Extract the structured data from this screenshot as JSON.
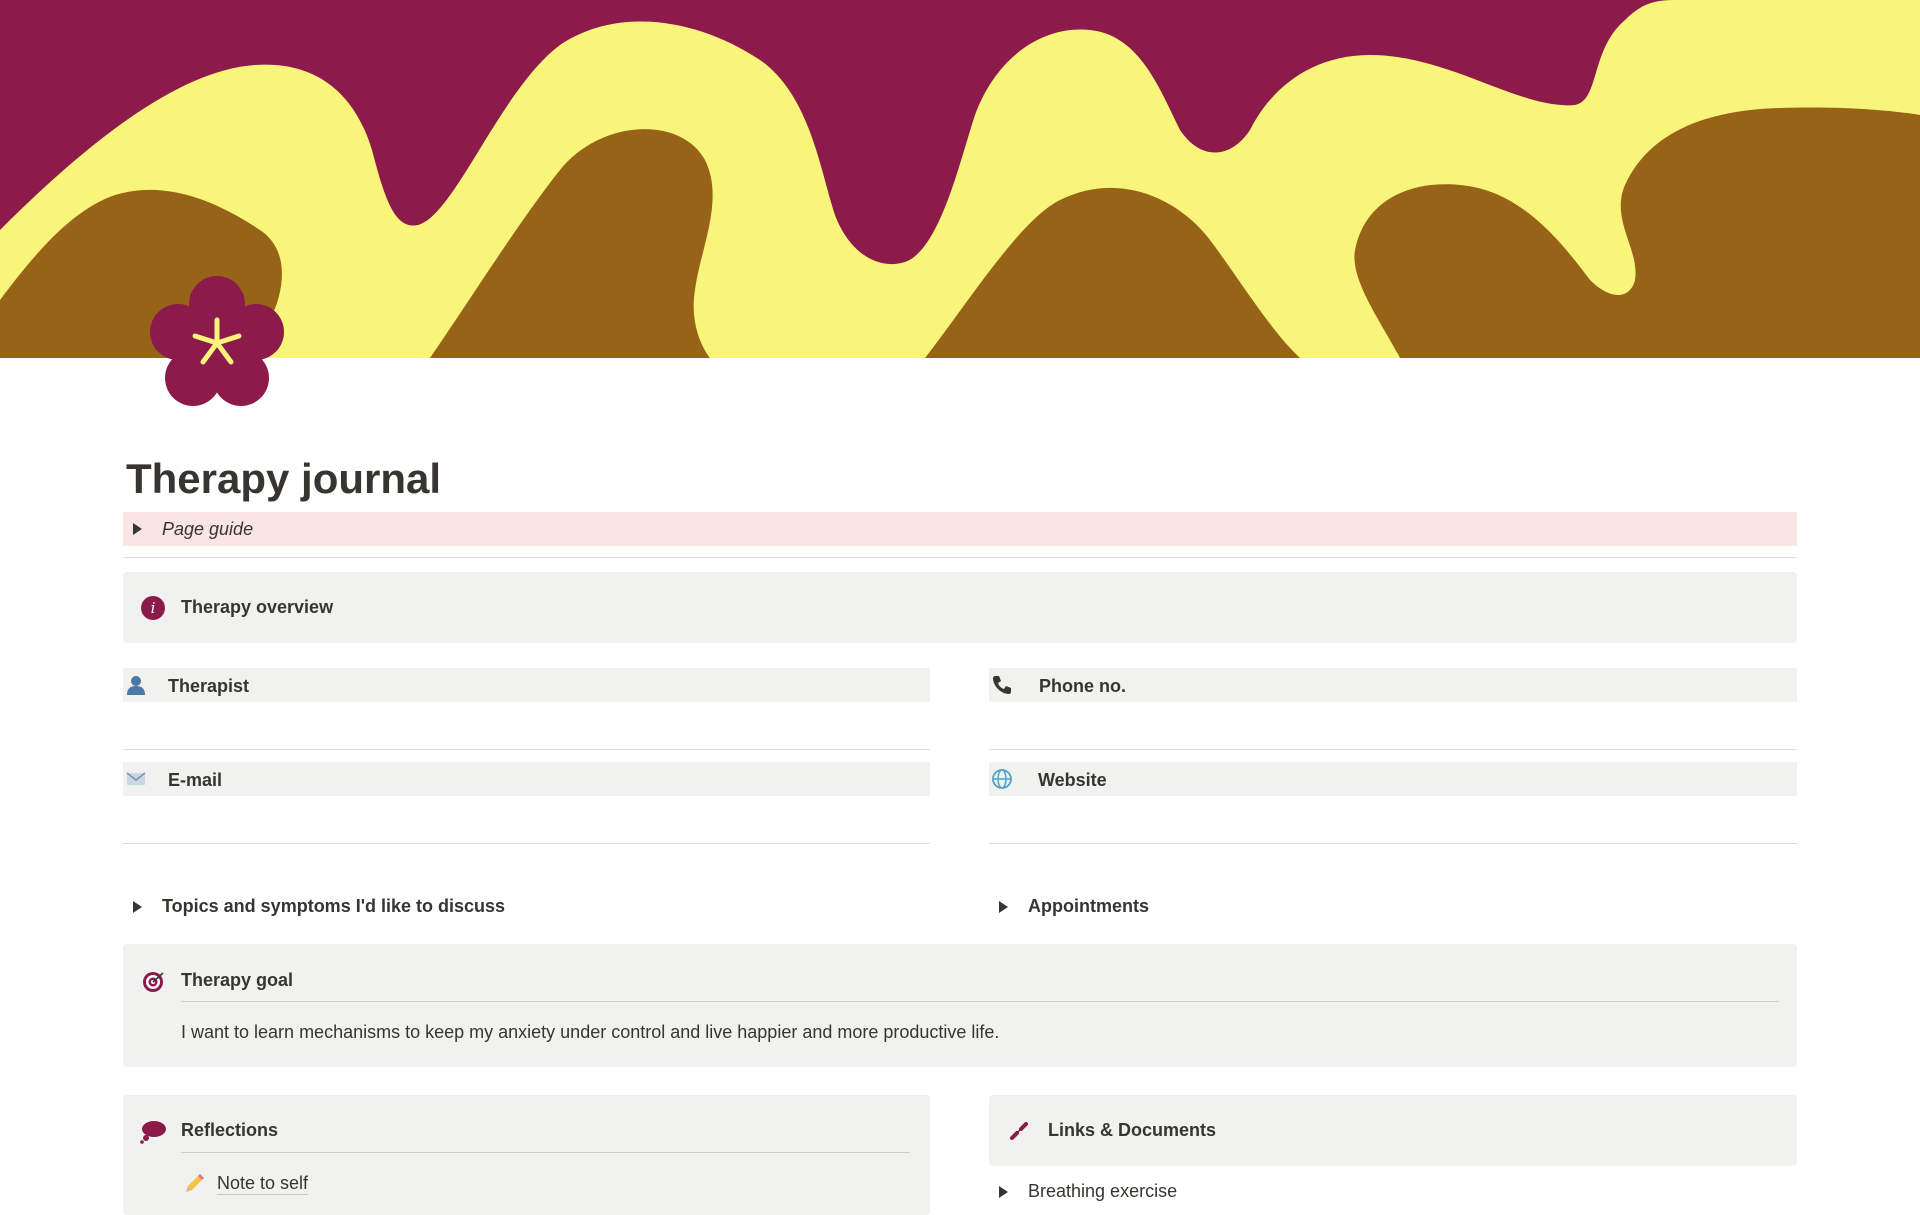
{
  "page": {
    "title": "Therapy journal",
    "page_guide_label": "Page guide"
  },
  "overview": {
    "title": "Therapy overview"
  },
  "fields": {
    "therapist": "Therapist",
    "phone": "Phone no.",
    "email": "E-mail",
    "website": "Website"
  },
  "toggles": {
    "topics": "Topics and symptoms I'd like to discuss",
    "appointments": "Appointments"
  },
  "goal": {
    "title": "Therapy goal",
    "text": "I want to learn mechanisms to keep my anxiety under control and live happier and more productive life."
  },
  "reflections": {
    "title": "Reflections",
    "item": "Note to self"
  },
  "links": {
    "title": "Links & Documents",
    "item": "Breathing exercise"
  },
  "colors": {
    "cover_wine": "#8c1a4a",
    "cover_yellow": "#f8f57a",
    "cover_brown": "#976318",
    "page_guide_bg": "#fbe4e4",
    "callout_bg": "#f1f1ef",
    "accent": "#8b1a4a"
  },
  "icons": {
    "page_icon": "flower-icon",
    "overview_icon": "info-icon",
    "therapist_icon": "person-icon",
    "phone_icon": "phone-icon",
    "email_icon": "envelope-icon",
    "website_icon": "globe-icon",
    "goal_icon": "target-icon",
    "reflections_icon": "thought-bubble-icon",
    "note_icon": "pencil-icon",
    "links_icon": "link-icon"
  }
}
